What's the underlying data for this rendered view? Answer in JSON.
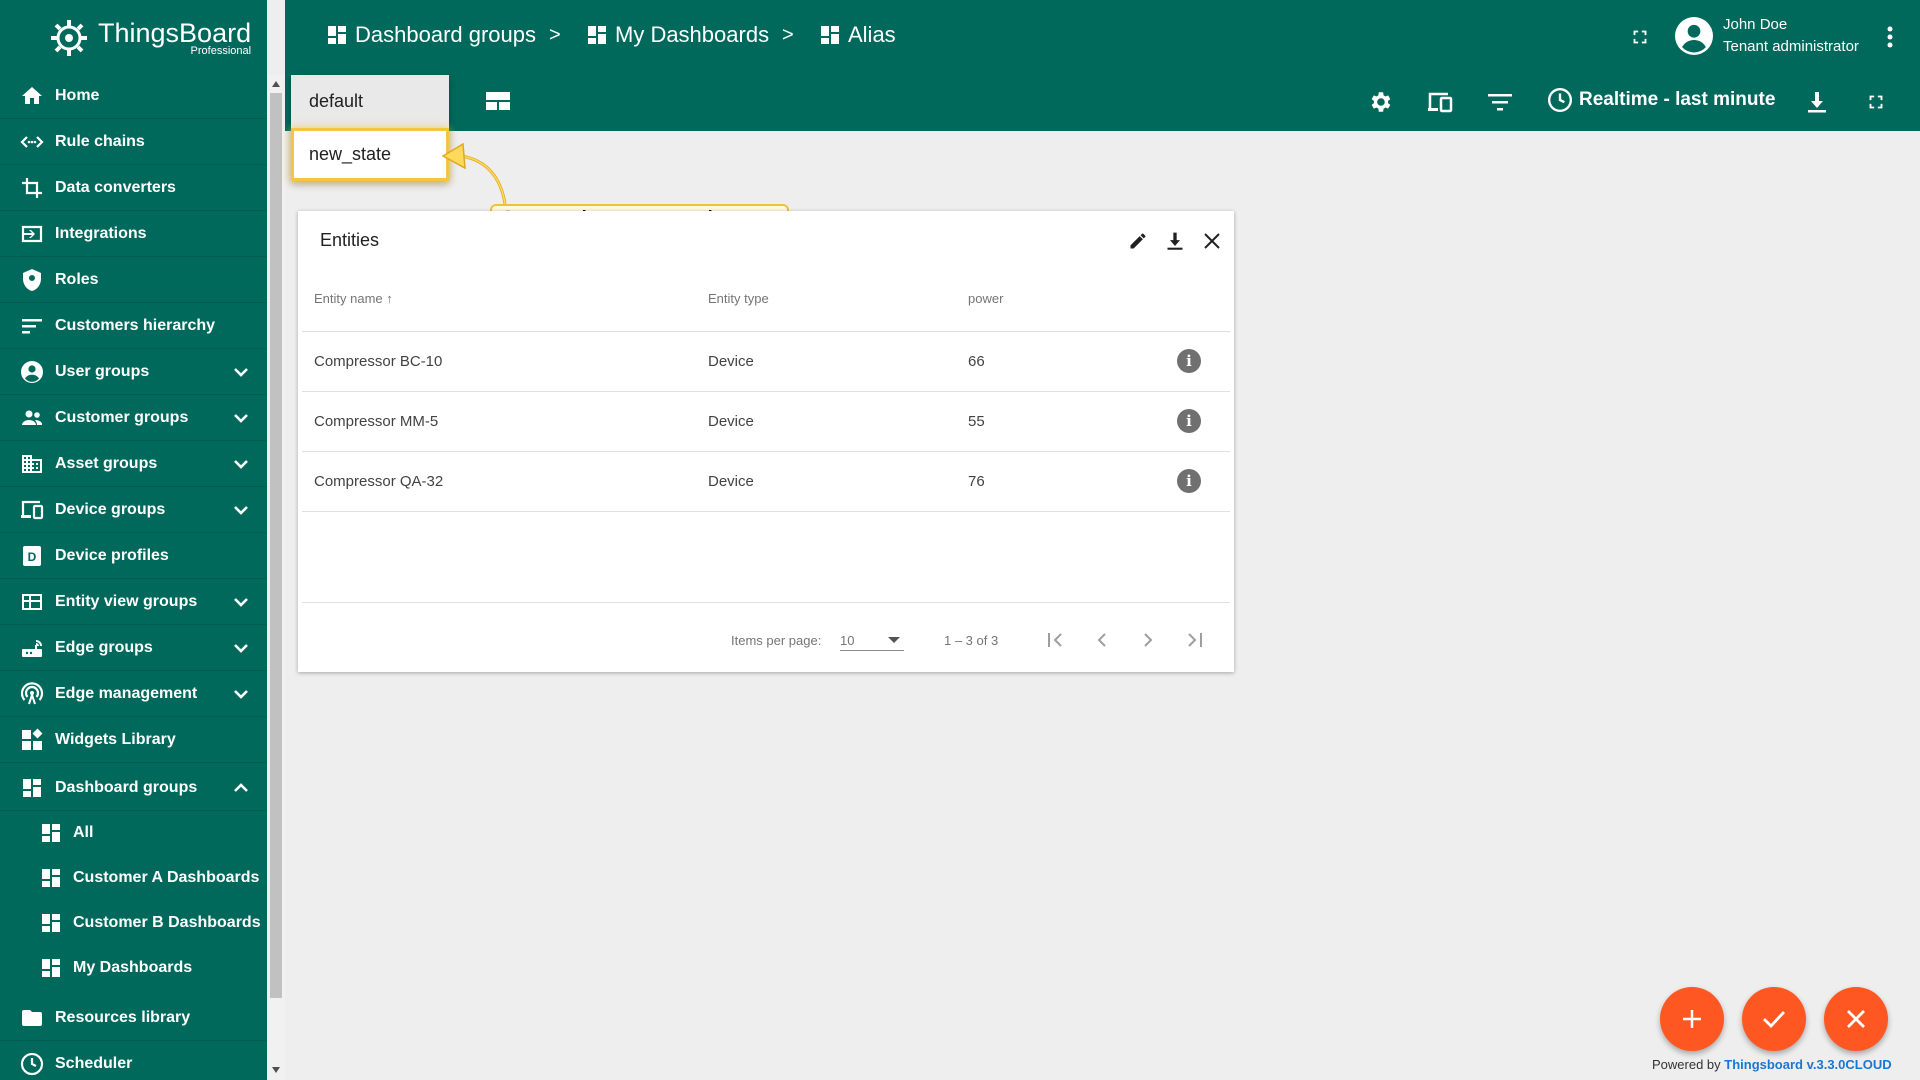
{
  "app": {
    "logo_name": "ThingsBoard",
    "logo_sub": "Professional"
  },
  "sidebar": {
    "items": [
      {
        "label": "Home",
        "icon": "home-icon"
      },
      {
        "label": "Rule chains",
        "icon": "rule-chains-icon"
      },
      {
        "label": "Data converters",
        "icon": "converters-icon"
      },
      {
        "label": "Integrations",
        "icon": "integrations-icon"
      },
      {
        "label": "Roles",
        "icon": "shield-icon"
      },
      {
        "label": "Customers hierarchy",
        "icon": "hierarchy-icon"
      },
      {
        "label": "User groups",
        "icon": "account-circle-icon"
      },
      {
        "label": "Customer groups",
        "icon": "supervisor-icon"
      },
      {
        "label": "Asset groups",
        "icon": "domain-icon"
      },
      {
        "label": "Device groups",
        "icon": "devices-icon"
      },
      {
        "label": "Device profiles",
        "icon": "device-profile-icon"
      },
      {
        "label": "Entity view groups",
        "icon": "view-quilt-icon"
      },
      {
        "label": "Edge groups",
        "icon": "router-icon"
      },
      {
        "label": "Edge management",
        "icon": "wifi-tethering-icon"
      },
      {
        "label": "Widgets Library",
        "icon": "widgets-icon"
      },
      {
        "label": "Dashboard groups",
        "icon": "dashboard-icon"
      },
      {
        "label": "All",
        "icon": "dashboard-icon"
      },
      {
        "label": "Customer A Dashboards",
        "icon": "dashboard-icon"
      },
      {
        "label": "Customer B Dashboards",
        "icon": "dashboard-icon"
      },
      {
        "label": "My Dashboards",
        "icon": "dashboard-icon"
      },
      {
        "label": "Resources library",
        "icon": "folder-icon"
      },
      {
        "label": "Scheduler",
        "icon": "clock-icon"
      }
    ]
  },
  "header": {
    "breadcrumbs": [
      "Dashboard groups",
      "My Dashboards",
      "Alias"
    ],
    "separator": ">",
    "user_name": "John Doe",
    "user_role": "Tenant administrator",
    "timewindow": "Realtime - last minute"
  },
  "state_menu": {
    "options": [
      "default",
      "new_state"
    ]
  },
  "callout": {
    "text": "Go to the created state"
  },
  "widget": {
    "title": "Entities",
    "columns": [
      "Entity name",
      "Entity type",
      "power"
    ],
    "rows": [
      [
        "Compressor BC-10",
        "Device",
        "66"
      ],
      [
        "Compressor MM-5",
        "Device",
        "55"
      ],
      [
        "Compressor QA-32",
        "Device",
        "76"
      ]
    ],
    "items_per_page_label": "Items per page:",
    "items_per_page": "10",
    "range": "1 – 3 of 3"
  },
  "footer": {
    "powered_prefix": "Powered by ",
    "powered_link": "Thingsboard v.3.3.0CLOUD"
  },
  "colors": {
    "primary": "#00695c",
    "accent": "#ff5722",
    "callout_border": "#f0c040"
  }
}
